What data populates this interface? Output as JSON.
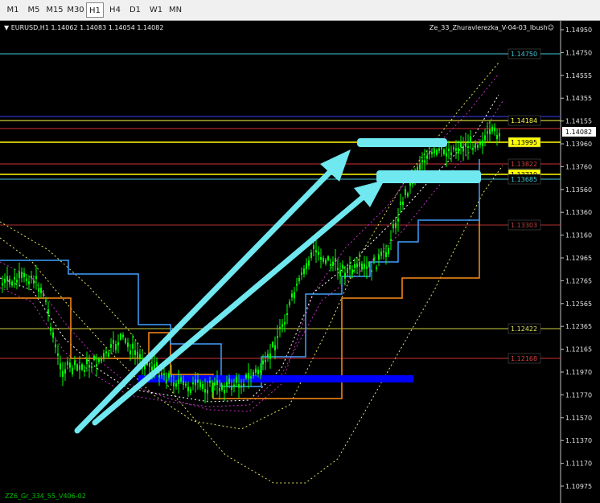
{
  "timeframes": [
    "M1",
    "M5",
    "M15",
    "M30",
    "H1",
    "H4",
    "D1",
    "W1",
    "MN"
  ],
  "active_timeframe": "H1",
  "symbol_info": "▼ EURUSD,H1  1.14062 1.14083 1.14054 1.14082",
  "indicator_title": "Ze_33_Zhuravlerezka_V-04-03_Ibush☺",
  "bottom_indicator": "ZZ6_Gr_334_55_V406-02",
  "price_axis": [
    "1.14950",
    "1.14750",
    "1.14555",
    "1.14355",
    "1.14155",
    "1.13960",
    "1.13760",
    "1.13560",
    "1.13360",
    "1.13160",
    "1.12965",
    "1.12765",
    "1.12565",
    "1.12365",
    "1.12165",
    "1.11970",
    "1.11770",
    "1.11570",
    "1.11370",
    "1.11170",
    "1.10975"
  ],
  "current_price": "1.14082",
  "level_labels": [
    {
      "text": "1.14750",
      "color": "#40c8d8"
    },
    {
      "text": "1.14184",
      "color": "#ffff40"
    },
    {
      "text": "1.13995",
      "color": "#000000",
      "bg": "#ffff00"
    },
    {
      "text": "1.13822",
      "color": "#d04040"
    },
    {
      "text": "1.13719",
      "color": "#000000",
      "bg": "#ffff00"
    },
    {
      "text": "1.13685",
      "color": "#40c8d8"
    },
    {
      "text": "1.13303",
      "color": "#c04040"
    },
    {
      "text": "1.12422",
      "color": "#e0e060"
    },
    {
      "text": "1.12168",
      "color": "#d04040"
    }
  ],
  "colors": {
    "background": "#000000",
    "candle": "#00ff00",
    "annotation": "#70e8f0",
    "blue_box": "#0000ff",
    "orange_channel": "#ff8c1a",
    "blue_channel": "#3fa0ff"
  }
}
